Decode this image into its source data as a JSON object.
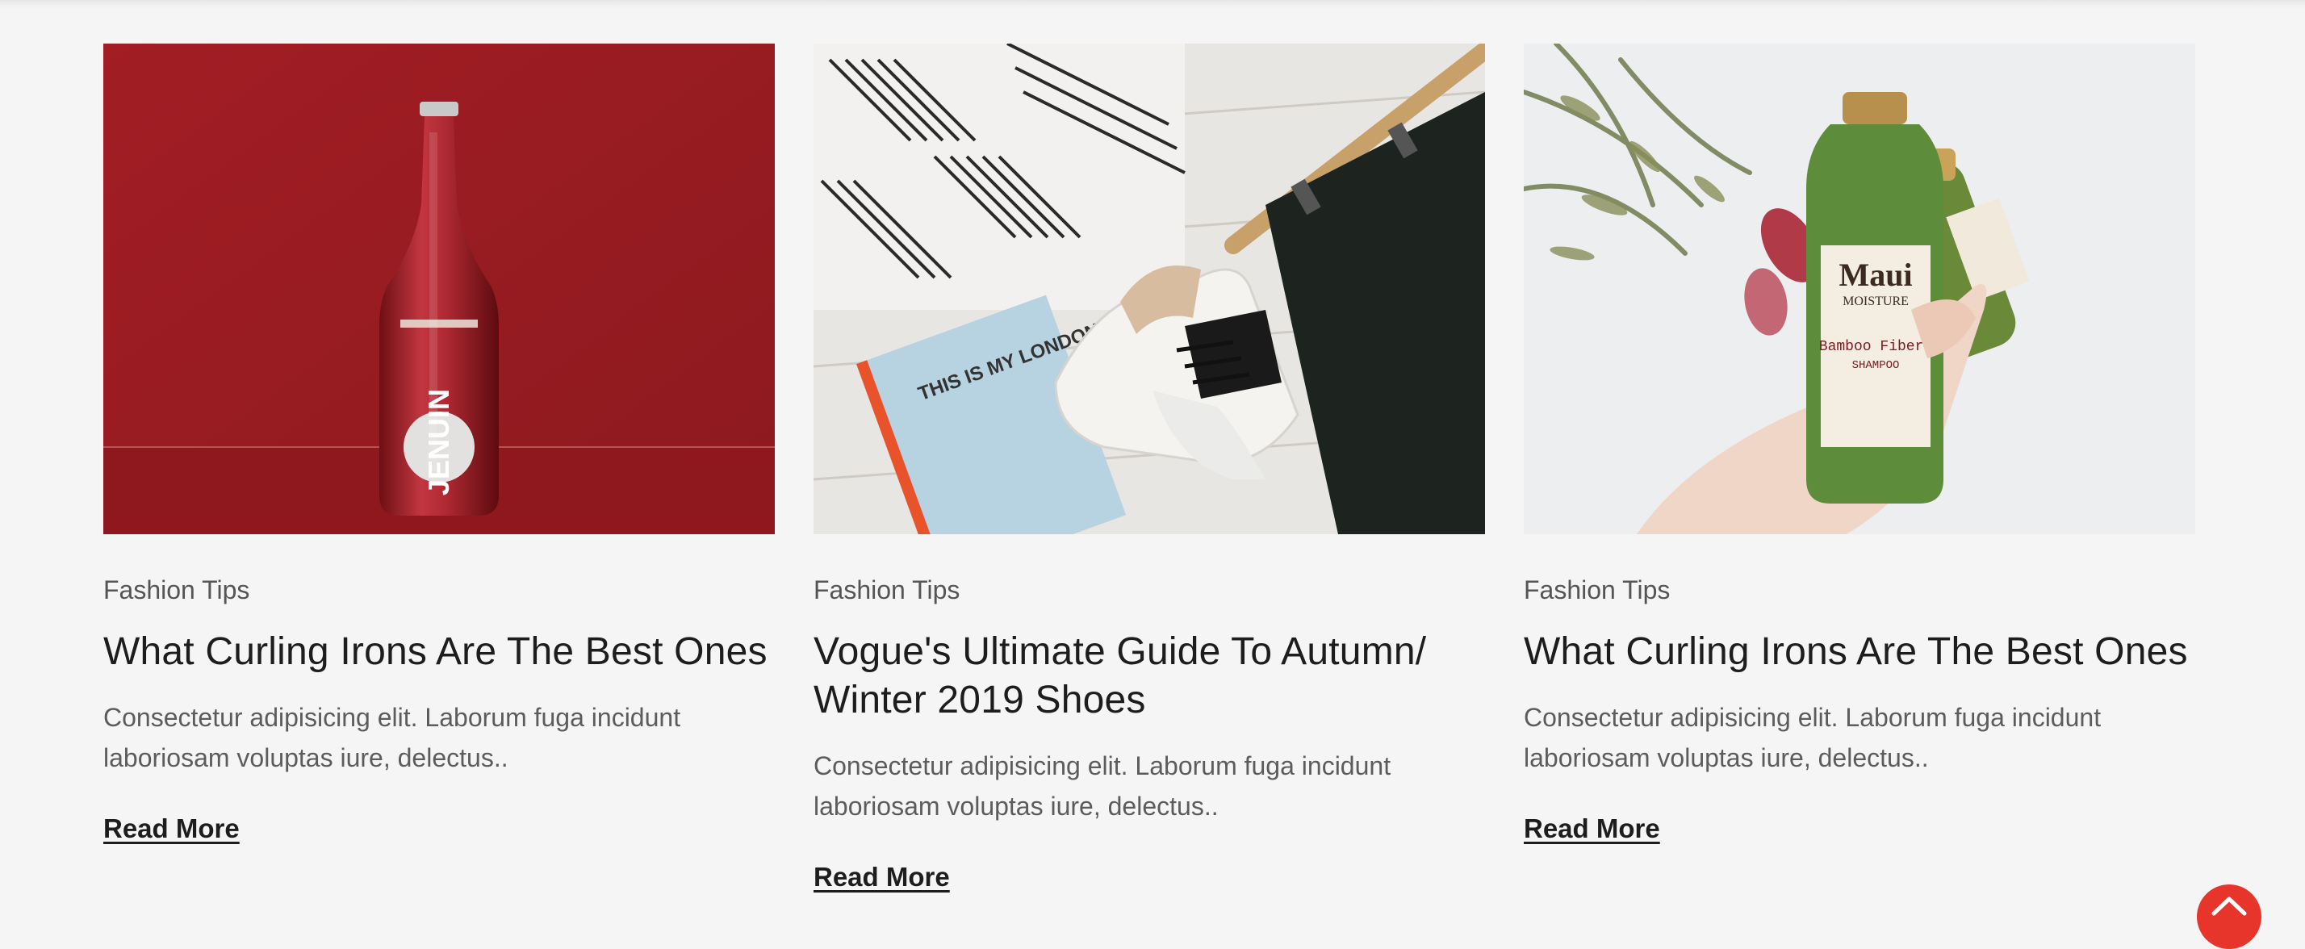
{
  "posts": [
    {
      "category": "Fashion Tips",
      "title": "What Curling Irons Are The Best Ones",
      "excerpt": "Consectetur adipisicing elit. Laborum fuga incidunt laboriosam voluptas iure, delectus..",
      "read_more": "Read More",
      "image_icon": "red-bottle-photo",
      "bottle_label": "JENUIN"
    },
    {
      "category": "Fashion Tips",
      "title": "Vogue's Ultimate Guide To Autumn/ Winter 2019 Shoes",
      "excerpt": "Consectetur adipisicing elit. Laborum fuga incidunt laboriosam voluptas iure, delectus..",
      "read_more": "Read More",
      "image_icon": "flatlay-fashion-photo",
      "notebook_text": "THIS IS MY LONDON"
    },
    {
      "category": "Fashion Tips",
      "title": "What Curling Irons Are The Best Ones",
      "excerpt": "Consectetur adipisicing elit. Laborum fuga incidunt laboriosam voluptas iure, delectus..",
      "read_more": "Read More",
      "image_icon": "shampoo-bottle-photo",
      "brand": "Maui",
      "brand_sub": "MOISTURE",
      "product": "Bamboo Fibers",
      "product_type": "SHAMPOO"
    }
  ],
  "colors": {
    "accent": "#e8352b",
    "background": "#f5f5f5"
  },
  "scroll_top_icon": "chevron-up-icon"
}
